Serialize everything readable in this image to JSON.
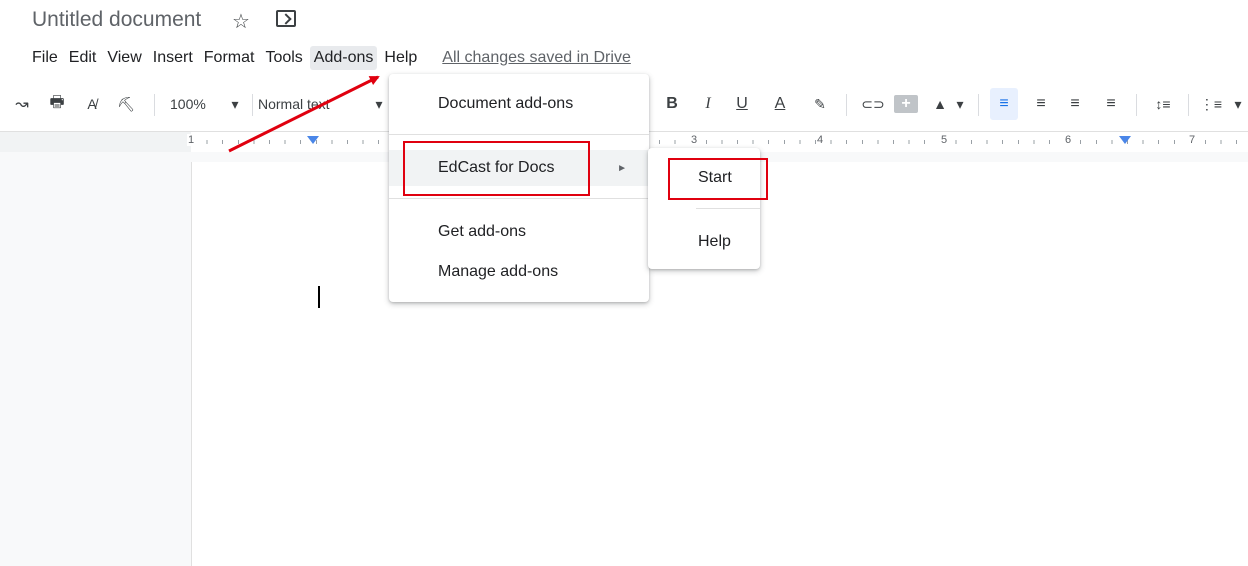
{
  "document": {
    "title": "Untitled document"
  },
  "header_icons": [
    "star-icon",
    "folder-move-icon"
  ],
  "menubar": {
    "items": [
      "File",
      "Edit",
      "View",
      "Insert",
      "Format",
      "Tools",
      "Add-ons",
      "Help"
    ],
    "save_status": "All changes saved in Drive"
  },
  "toolbar": {
    "redo_icon": "↝",
    "print_icon": "🖶",
    "spellcheck_icon": "A̸",
    "paint_format_icon": "⛏",
    "zoom": "100%",
    "style": "Normal text",
    "bold": "B",
    "italic": "I",
    "underline": "U",
    "text_color": "A",
    "highlight_icon": "✎",
    "link_icon": "⊂⊃",
    "comment_icon": "+",
    "image_icon": "▲",
    "align_left_icon": "≡",
    "align_center_icon": "≡",
    "align_right_icon": "≡",
    "justify_icon": "≡",
    "line_spacing_icon": "↕≡",
    "list_icon": "⋮≡",
    "dropdown_arrow": "▾"
  },
  "ruler": {
    "numbers": [
      "1",
      "3",
      "4",
      "5",
      "6",
      "7"
    ]
  },
  "addons_menu": {
    "items": [
      "Document add-ons",
      "EdCast for Docs",
      "Get add-ons",
      "Manage add-ons"
    ],
    "submenu_arrow": "►"
  },
  "edcast_submenu": {
    "items": [
      "Start",
      "Help"
    ]
  },
  "annotation_color": "#e0000f",
  "accent_color": "#1a73e8"
}
